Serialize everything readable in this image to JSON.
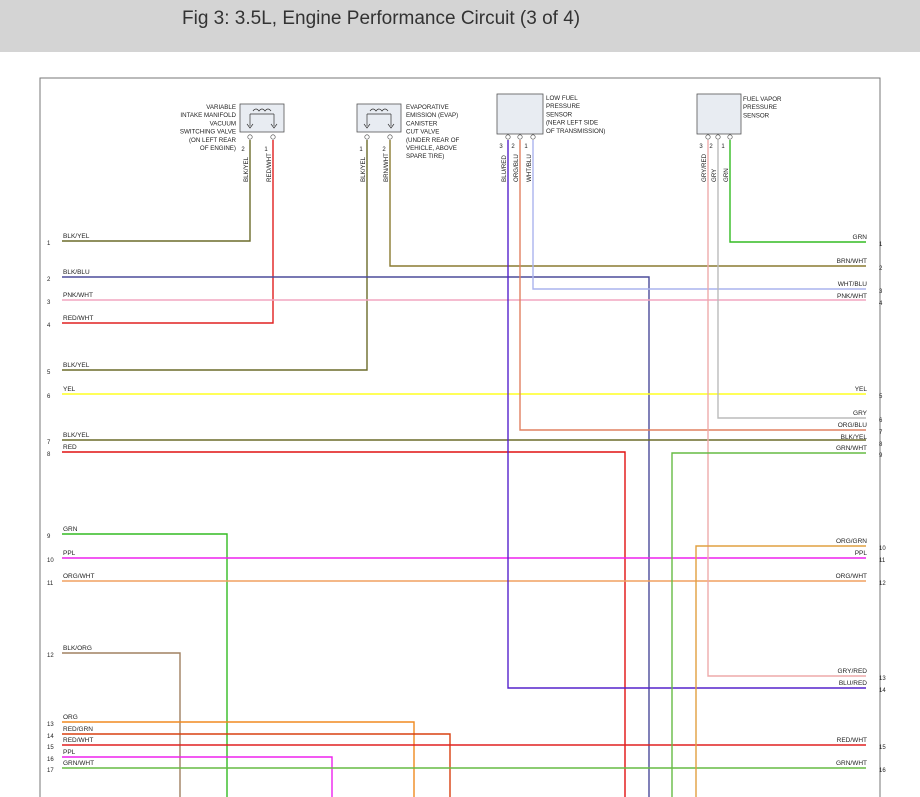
{
  "header": {
    "title": "Fig 3: 3.5L, Engine Performance Circuit (3 of 4)"
  },
  "components": [
    {
      "id": "vacuum-switching-valve",
      "label_lines": [
        "VARIABLE",
        "INTAKE MANIFOLD",
        "VACUUM",
        "SWITCHING VALVE",
        "(ON LEFT REAR",
        "OF ENGINE)"
      ],
      "pins": [
        {
          "num": "2",
          "wire": "BLK/YEL"
        },
        {
          "num": "1",
          "wire": "RED/WHT"
        }
      ]
    },
    {
      "id": "evap-cut-valve",
      "label_lines": [
        "EVAPORATIVE",
        "EMISSION (EVAP)",
        "CANISTER",
        "CUT VALVE",
        "(UNDER REAR OF",
        "VEHICLE, ABOVE",
        "SPARE TIRE)"
      ],
      "pins": [
        {
          "num": "1",
          "wire": "BLK/YEL"
        },
        {
          "num": "2",
          "wire": "BRN/WHT"
        }
      ]
    },
    {
      "id": "low-fuel-pressure-sensor",
      "label_lines": [
        "LOW FUEL",
        "PRESSURE",
        "SENSOR",
        "(NEAR LEFT SIDE",
        "OF TRANSMISSION)"
      ],
      "pins": [
        {
          "num": "3",
          "wire": "BLU/RED"
        },
        {
          "num": "2",
          "wire": "ORG/BLU"
        },
        {
          "num": "1",
          "wire": "WHT/BLU"
        }
      ]
    },
    {
      "id": "fuel-vapor-pressure-sensor",
      "label_lines": [
        "FUEL VAPOR",
        "PRESSURE",
        "SENSOR"
      ],
      "pins": [
        {
          "num": "3",
          "wire": "GRY/RED"
        },
        {
          "num": "2",
          "wire": "GRY"
        },
        {
          "num": "1",
          "wire": "GRN"
        }
      ]
    }
  ],
  "left_connector": [
    {
      "pin": "1",
      "wire": "BLK/YEL"
    },
    {
      "pin": "2",
      "wire": "BLK/BLU"
    },
    {
      "pin": "3",
      "wire": "PNK/WHT"
    },
    {
      "pin": "4",
      "wire": "RED/WHT"
    },
    {
      "pin": "5",
      "wire": "BLK/YEL"
    },
    {
      "pin": "6",
      "wire": "YEL"
    },
    {
      "pin": "7",
      "wire": "BLK/YEL"
    },
    {
      "pin": "8",
      "wire": "RED"
    },
    {
      "pin": "9",
      "wire": "GRN"
    },
    {
      "pin": "10",
      "wire": "PPL"
    },
    {
      "pin": "11",
      "wire": "ORG/WHT"
    },
    {
      "pin": "12",
      "wire": "BLK/ORG"
    },
    {
      "pin": "13",
      "wire": "ORG"
    },
    {
      "pin": "14",
      "wire": "RED/GRN"
    },
    {
      "pin": "15",
      "wire": "RED/WHT"
    },
    {
      "pin": "16",
      "wire": "PPL"
    },
    {
      "pin": "17",
      "wire": "GRN/WHT"
    }
  ],
  "right_connector": [
    {
      "pin": "1",
      "wire": "GRN"
    },
    {
      "pin": "2",
      "wire": "BRN/WHT"
    },
    {
      "pin": "3",
      "wire": "WHT/BLU"
    },
    {
      "pin": "4",
      "wire": "PNK/WHT"
    },
    {
      "pin": "5",
      "wire": "YEL"
    },
    {
      "pin": "6",
      "wire": "GRY"
    },
    {
      "pin": "7",
      "wire": "ORG/BLU"
    },
    {
      "pin": "8",
      "wire": "BLK/YEL"
    },
    {
      "pin": "9",
      "wire": "GRN/WHT"
    },
    {
      "pin": "10",
      "wire": "ORG/GRN"
    },
    {
      "pin": "11",
      "wire": "PPL"
    },
    {
      "pin": "12",
      "wire": "ORG/WHT"
    },
    {
      "pin": "13",
      "wire": "GRY/RED"
    },
    {
      "pin": "14",
      "wire": "BLU/RED"
    },
    {
      "pin": "15",
      "wire": "RED/WHT"
    },
    {
      "pin": "16",
      "wire": "GRN/WHT"
    }
  ],
  "wire_colors": {
    "BLK/YEL": "#6b6b2a",
    "BLK/BLU": "#4b4b9a",
    "PNK/WHT": "#f2a5c0",
    "RED/WHT": "#e02020",
    "YEL": "#ffff22",
    "RED": "#e01010",
    "GRN": "#33bb22",
    "PPL": "#ee22ee",
    "ORG/WHT": "#f0a060",
    "BLK/ORG": "#a08060",
    "ORG": "#f08a20",
    "RED/GRN": "#d84010",
    "GRN/WHT": "#66bb44",
    "BRN/WHT": "#8a7a30",
    "WHT/BLU": "#aab4ee",
    "GRY": "#bbbbbb",
    "ORG/BLU": "#e08060",
    "ORG/GRN": "#e0a040",
    "GRY/RED": "#eeaaaa",
    "BLU/RED": "#5522cc"
  }
}
